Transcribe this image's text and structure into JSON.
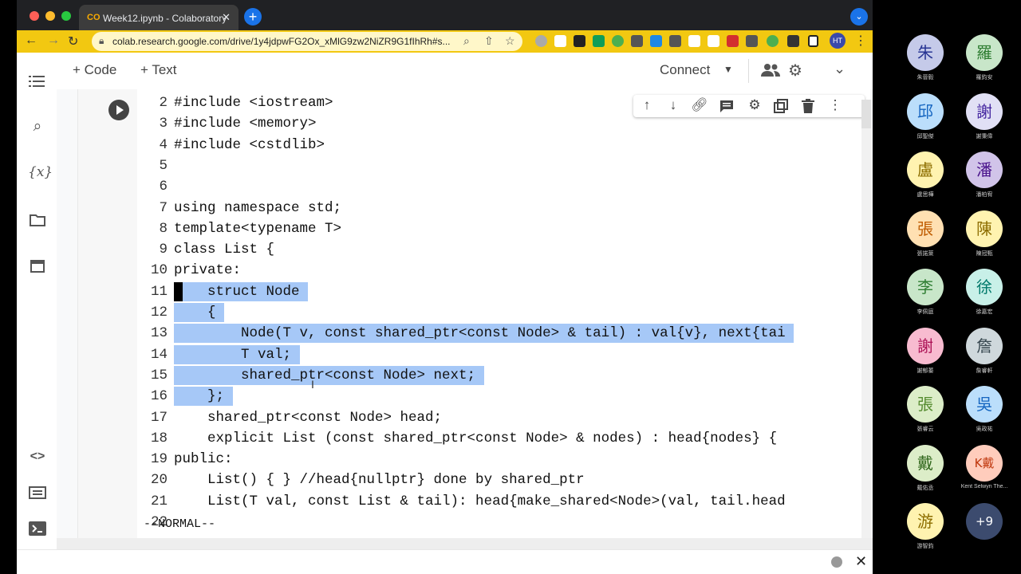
{
  "browser": {
    "tab_title": "Week12.ipynb - Colaboratory",
    "tab_favicon": "CO",
    "tab_close": "✕",
    "new_tab": "+",
    "tab_menu": "⌄",
    "url": "colab.research.google.com/drive/1y4jdpwFG2Ox_xMlG9zw2NiZR9G1fIhRh#s...",
    "profile_initials": "HT",
    "menu": "⋮",
    "colors": {
      "toolbar": "#f2c811",
      "tabbar": "#202124",
      "new_tab": "#1a73e8"
    }
  },
  "colab": {
    "add_code": "+ Code",
    "add_text": "+ Text",
    "connect": "Connect",
    "connect_caret": "▼",
    "status_line": "--NORMAL--"
  },
  "code_lines": [
    {
      "n": "2",
      "text": "#include <iostream>"
    },
    {
      "n": "3",
      "text": "#include <memory>"
    },
    {
      "n": "4",
      "text": "#include <cstdlib>"
    },
    {
      "n": "5",
      "text": ""
    },
    {
      "n": "6",
      "text": ""
    },
    {
      "n": "7",
      "text": "using namespace std;"
    },
    {
      "n": "8",
      "text": "template<typename T>"
    },
    {
      "n": "9",
      "text": "class List {"
    },
    {
      "n": "10",
      "text": "private:"
    },
    {
      "n": "11",
      "text": "    struct Node"
    },
    {
      "n": "12",
      "text": "    {"
    },
    {
      "n": "13",
      "text": "        Node(T v, const shared_ptr<const Node> & tail) : val{v}, next{tai"
    },
    {
      "n": "14",
      "text": "        T val;"
    },
    {
      "n": "15",
      "text": "        shared_ptr<const Node> next;"
    },
    {
      "n": "16",
      "text": "    };"
    },
    {
      "n": "17",
      "text": "    shared_ptr<const Node> head;"
    },
    {
      "n": "18",
      "text": "    explicit List (const shared_ptr<const Node> & nodes) : head{nodes} {"
    },
    {
      "n": "19",
      "text": "public:"
    },
    {
      "n": "20",
      "text": "    List() { } //head{nullptr} done by shared_ptr"
    },
    {
      "n": "21",
      "text": "    List(T val, const List & tail): head{make_shared<Node>(val, tail.head"
    },
    {
      "n": "22",
      "text": ""
    }
  ],
  "selection_color": "#a6c8f7",
  "participants": [
    {
      "char": "朱",
      "name": "朱晉毅",
      "bg": "#c5cae9",
      "fg": "#283593"
    },
    {
      "char": "羅",
      "name": "羅鈞安",
      "bg": "#c8e6c9",
      "fg": "#2e7d32"
    },
    {
      "char": "邱",
      "name": "邱聖傑",
      "bg": "#bbdefb",
      "fg": "#1565c0"
    },
    {
      "char": "謝",
      "name": "謝秉偉",
      "bg": "#e1e0f5",
      "fg": "#4527a0"
    },
    {
      "char": "盧",
      "name": "盧思樺",
      "bg": "#fff3b0",
      "fg": "#8d6e00"
    },
    {
      "char": "潘",
      "name": "潘柏宥",
      "bg": "#d1c4e9",
      "fg": "#4a148c"
    },
    {
      "char": "張",
      "name": "張諾萊",
      "bg": "#ffe0b2",
      "fg": "#bf5b00"
    },
    {
      "char": "陳",
      "name": "陳冠甄",
      "bg": "#fff3b0",
      "fg": "#8d6e00"
    },
    {
      "char": "李",
      "name": "李佩庭",
      "bg": "#c8e6c9",
      "fg": "#2e7d32"
    },
    {
      "char": "徐",
      "name": "徐嘉宏",
      "bg": "#c8f0e8",
      "fg": "#00796b"
    },
    {
      "char": "謝",
      "name": "謝郁蓁",
      "bg": "#f8bbd0",
      "fg": "#ad1457"
    },
    {
      "char": "詹",
      "name": "詹睿軒",
      "bg": "#cfd8dc",
      "fg": "#37474f"
    },
    {
      "char": "張",
      "name": "張睿云",
      "bg": "#dcedc8",
      "fg": "#558b2f"
    },
    {
      "char": "吳",
      "name": "吳政祐",
      "bg": "#bbdefb",
      "fg": "#1565c0"
    },
    {
      "char": "戴",
      "name": "戴佑丞",
      "bg": "#dcedc8",
      "fg": "#33691e"
    },
    {
      "char": "K戴",
      "name": "Kent Selwyn The...",
      "bg": "#ffccbc",
      "fg": "#bf360c"
    },
    {
      "char": "游",
      "name": "游智鈞",
      "bg": "#fff3b0",
      "fg": "#8d6e00"
    },
    {
      "char": "+9",
      "name": "",
      "bg": "#3c4b6e",
      "fg": "#ffffff"
    }
  ]
}
